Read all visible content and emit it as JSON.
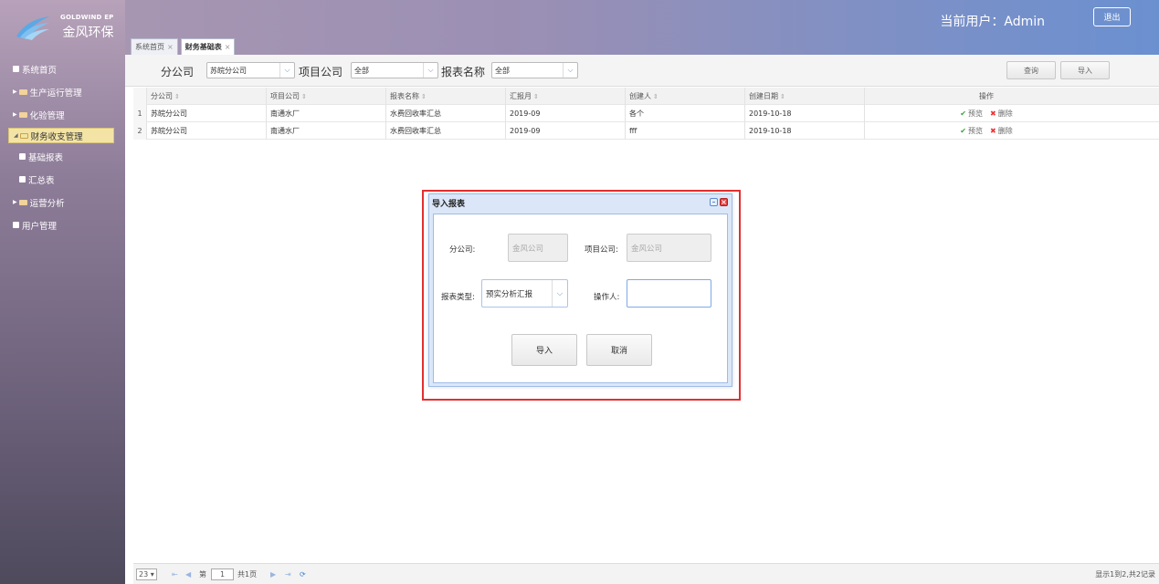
{
  "logo": {
    "en": "GOLDWIND EP",
    "cn": "金风环保"
  },
  "sidebar": {
    "items": [
      {
        "label": "系统首页"
      },
      {
        "label": "生产运行管理"
      },
      {
        "label": "化验管理"
      },
      {
        "label": "财务收支管理"
      },
      {
        "label": "基础报表"
      },
      {
        "label": "汇总表"
      },
      {
        "label": "运营分析"
      },
      {
        "label": "用户管理"
      }
    ]
  },
  "header": {
    "user": "当前用户：Admin",
    "logout": "退出",
    "tabs": [
      {
        "label": "系统首页",
        "close": "×"
      },
      {
        "label": "财务基础表",
        "close": "×"
      }
    ]
  },
  "filter": {
    "branch_label": "分公司",
    "branch_value": "苏皖分公司",
    "project_label": "项目公司",
    "project_value": "全部",
    "report_label": "报表名称",
    "report_value": "全部",
    "query": "查询",
    "import": "导入"
  },
  "table": {
    "columns": [
      "分公司",
      "项目公司",
      "报表名称",
      "汇报月",
      "创建人",
      "创建日期",
      "操作"
    ],
    "rows": [
      {
        "num": "1",
        "branch": "苏皖分公司",
        "project": "南通水厂",
        "report": "水费回收率汇总",
        "month": "2019-09",
        "creator": "各个",
        "date": "2019-10-18"
      },
      {
        "num": "2",
        "branch": "苏皖分公司",
        "project": "南通水厂",
        "report": "水费回收率汇总",
        "month": "2019-09",
        "creator": "fff",
        "date": "2019-10-18"
      }
    ],
    "preview": "预览",
    "delete": "删除"
  },
  "footer": {
    "page_size": "23",
    "page_prefix": "第",
    "page": "1",
    "page_suffix": "共1页",
    "summary": "显示1到2,共2记录"
  },
  "dialog": {
    "title": "导入报表",
    "branch_label": "分公司:",
    "branch_value": "金风公司",
    "project_label": "项目公司:",
    "project_value": "金风公司",
    "type_label": "报表类型:",
    "type_value": "预实分析汇报",
    "operator_label": "操作人:",
    "operator_value": "",
    "import": "导入",
    "cancel": "取消"
  }
}
